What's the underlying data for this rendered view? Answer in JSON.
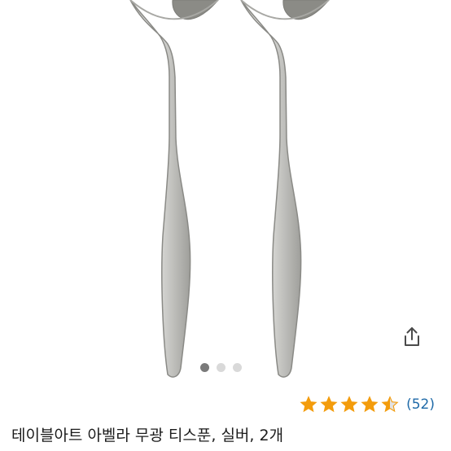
{
  "product": {
    "title": "테이블아트 아벨라 무광 티스푼, 실버, 2개",
    "image_count": 3,
    "active_image": 1,
    "rating": 4.5,
    "rating_max": 5,
    "review_count": "(52)"
  },
  "icons": {
    "share": "share-icon",
    "star": "star-icon"
  },
  "colors": {
    "star": "#f39c0c",
    "star_empty": "#e2e2e2",
    "review_count": "#1f6aa8",
    "dot_active": "#7a7a7a",
    "dot_inactive": "#d9d9d9"
  }
}
